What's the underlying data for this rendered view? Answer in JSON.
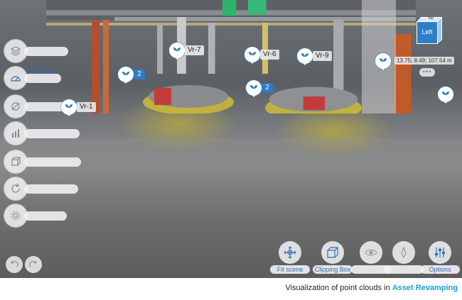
{
  "viewer": {
    "markers": [
      {
        "label": "Vr-7",
        "type": "tag"
      },
      {
        "label": "Vr-6",
        "type": "tag"
      },
      {
        "label": "Vr-9",
        "type": "tag"
      },
      {
        "label": "Vr-1",
        "type": "tag"
      },
      {
        "label": "2",
        "type": "badge"
      },
      {
        "label": "2",
        "type": "badge"
      },
      {
        "label": "",
        "type": "pin"
      },
      {
        "label": "",
        "type": "pin"
      }
    ],
    "coordinate_readout": "13.75; 8.49; 107.54 m",
    "nav_cube": {
      "front": "Left",
      "top": "Top"
    },
    "more_dots": "•••"
  },
  "left_tools": [
    {
      "icon": "layers-icon",
      "label": ""
    },
    {
      "icon": "measure-icon",
      "label": "Measure"
    },
    {
      "icon": "section-icon",
      "label": ""
    },
    {
      "icon": "chart-icon",
      "label": ""
    },
    {
      "icon": "box-icon",
      "label": ""
    },
    {
      "icon": "refresh-icon",
      "label": ""
    },
    {
      "icon": "settings-icon",
      "label": ""
    }
  ],
  "bottom_toolbar": [
    {
      "icon": "fit-scene-icon",
      "label": "Fit scene"
    },
    {
      "icon": "clipping-box-icon",
      "label": "Clipping Box"
    },
    {
      "icon": "eye-icon",
      "label": ""
    },
    {
      "icon": "pen-icon",
      "label": ""
    },
    {
      "icon": "sliders-icon",
      "label": "Options"
    }
  ],
  "caption": {
    "prefix": "Visualization of point clouds in ",
    "highlight": "Asset Revamping"
  },
  "colors": {
    "accent": "#2e7cc8",
    "highlight": "#1aa0d8",
    "label_text": "#2d6fb5"
  }
}
